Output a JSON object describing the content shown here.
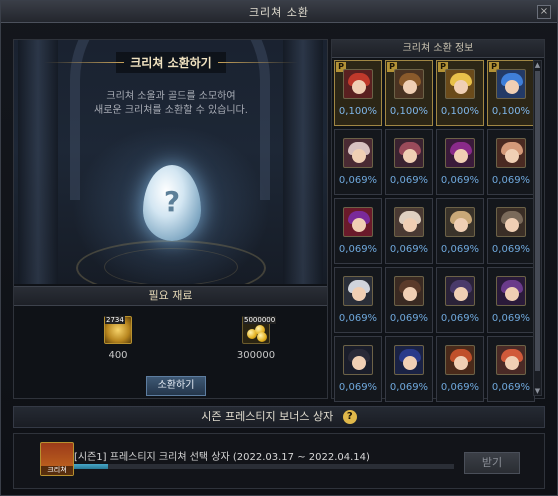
{
  "window": {
    "title": "크리쳐 소환",
    "close_label": "×"
  },
  "summon": {
    "heading": "크리쳐 소환하기",
    "description": "크리쳐 소울과 골드를 소모하여\n새로운 크리쳐를 소환할 수 있습니다.",
    "egg_symbol": "?",
    "materials_header": "필요 재료",
    "materials": [
      {
        "name": "creature-soul",
        "tag": "2734",
        "qty": "400"
      },
      {
        "name": "gold",
        "tag": "5000000",
        "qty": "300000"
      }
    ],
    "summon_button": "소환하기"
  },
  "info": {
    "header": "크리쳐 소환 정보",
    "premium_marker": "P",
    "creatures": [
      {
        "rate": "0,100%",
        "premium": true,
        "hair": "#c0392b",
        "bg": "#5a2020"
      },
      {
        "rate": "0,100%",
        "premium": true,
        "hair": "#8a5a2b",
        "bg": "#4a3322"
      },
      {
        "rate": "0,100%",
        "premium": true,
        "hair": "#e8c14a",
        "bg": "#6a4a1a"
      },
      {
        "rate": "0,100%",
        "premium": true,
        "hair": "#3f7fd9",
        "bg": "#233a66"
      },
      {
        "rate": "0,069%",
        "premium": false,
        "hair": "#d8c0c0",
        "bg": "#4a2a33"
      },
      {
        "rate": "0,069%",
        "premium": false,
        "hair": "#9a4a5a",
        "bg": "#3a2230"
      },
      {
        "rate": "0,069%",
        "premium": false,
        "hair": "#8a2a8a",
        "bg": "#3a1a3a"
      },
      {
        "rate": "0,069%",
        "premium": false,
        "hair": "#d49a7a",
        "bg": "#4a2a22"
      },
      {
        "rate": "0,069%",
        "premium": false,
        "hair": "#7a2a9a",
        "bg": "#6a1a2a"
      },
      {
        "rate": "0,069%",
        "premium": false,
        "hair": "#e0d0c0",
        "bg": "#4a3a33"
      },
      {
        "rate": "0,069%",
        "premium": false,
        "hair": "#c9a878",
        "bg": "#3a332a"
      },
      {
        "rate": "0,069%",
        "premium": false,
        "hair": "#7a6a5a",
        "bg": "#3a2e26"
      },
      {
        "rate": "0,069%",
        "premium": false,
        "hair": "#d0d4dc",
        "bg": "#2a2e38"
      },
      {
        "rate": "0,069%",
        "premium": false,
        "hair": "#5a3a2a",
        "bg": "#3a2a22"
      },
      {
        "rate": "0,069%",
        "premium": false,
        "hair": "#4a3a6a",
        "bg": "#2a2238"
      },
      {
        "rate": "0,069%",
        "premium": false,
        "hair": "#6a3a8a",
        "bg": "#2a1a3a"
      },
      {
        "rate": "0,069%",
        "premium": false,
        "hair": "#2a2a38",
        "bg": "#1a1d2a"
      },
      {
        "rate": "0,069%",
        "premium": false,
        "hair": "#2a3a8a",
        "bg": "#1a2244"
      },
      {
        "rate": "0,069%",
        "premium": false,
        "hair": "#c0502a",
        "bg": "#4a2a1a"
      },
      {
        "rate": "0,069%",
        "premium": false,
        "hair": "#d05a3a",
        "bg": "#4a2a26"
      }
    ]
  },
  "bonus": {
    "header": "시즌 프레스티지 보너스 상자",
    "help_symbol": "?",
    "item_icon_caption": "크리쳐",
    "item_name": "[시즌1] 프레스티지 크리쳐 선택 상자  (2022.03.17 ~ 2022.04.14)",
    "progress": 0.09,
    "claim_button": "받기"
  }
}
